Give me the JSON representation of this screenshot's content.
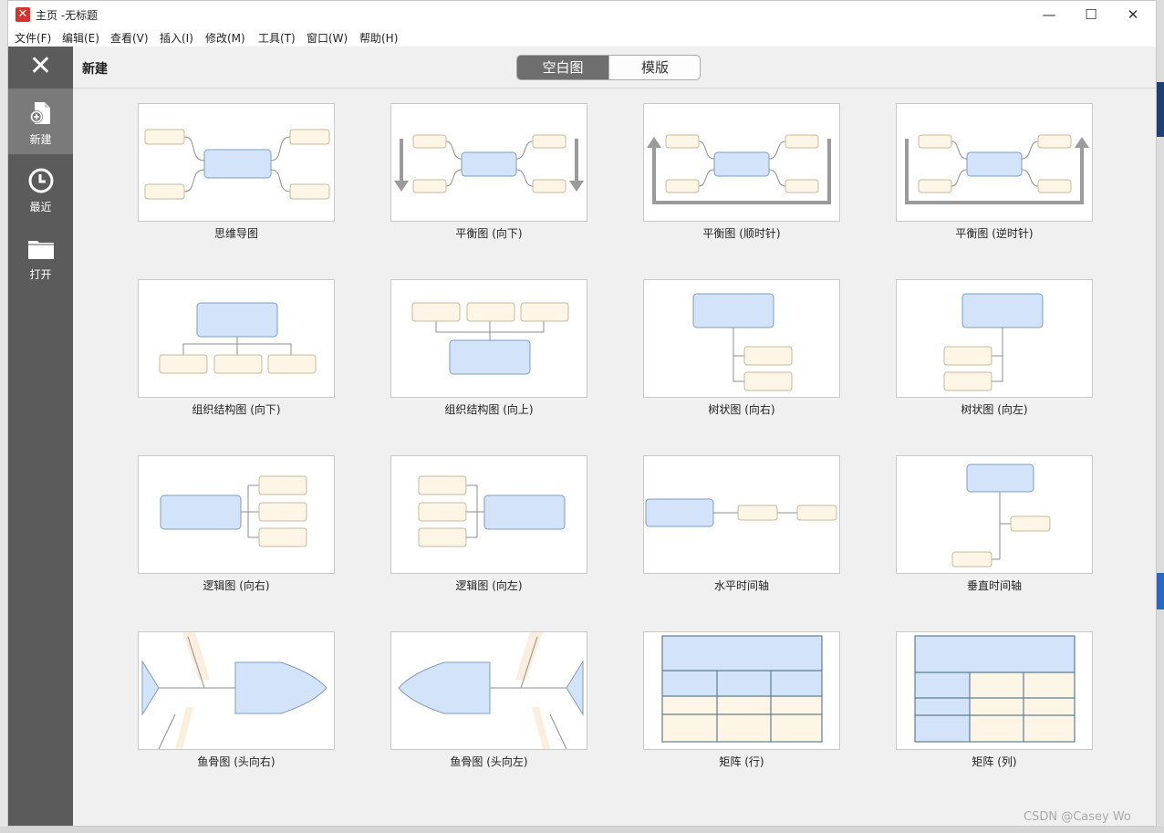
{
  "window": {
    "title": "主页 -无标题",
    "logo_glyph": "✕",
    "controls": {
      "minimize": "—",
      "maximize": "☐",
      "close": "✕"
    }
  },
  "menu": [
    "文件(F)",
    "编辑(E)",
    "查看(V)",
    "插入(I)",
    "修改(M)",
    "工具(T)",
    "窗口(W)",
    "帮助(H)"
  ],
  "sidebar": {
    "close_glyph": "✕",
    "items": [
      {
        "label": "新建",
        "icon": "new-file-icon",
        "active": true
      },
      {
        "label": "最近",
        "icon": "clock-icon",
        "active": false
      },
      {
        "label": "打开",
        "icon": "folder-icon",
        "active": false
      }
    ]
  },
  "header": {
    "title": "新建",
    "tabs": [
      {
        "label": "空白图",
        "active": true
      },
      {
        "label": "模版",
        "active": false
      }
    ]
  },
  "templates": [
    {
      "label": "思维导图",
      "kind": "mindmap"
    },
    {
      "label": "平衡图 (向下)",
      "kind": "balance-down"
    },
    {
      "label": "平衡图 (顺时针)",
      "kind": "balance-cw"
    },
    {
      "label": "平衡图 (逆时针)",
      "kind": "balance-ccw"
    },
    {
      "label": "组织结构图 (向下)",
      "kind": "org-down"
    },
    {
      "label": "组织结构图 (向上)",
      "kind": "org-up"
    },
    {
      "label": "树状图 (向右)",
      "kind": "tree-right"
    },
    {
      "label": "树状图 (向左)",
      "kind": "tree-left"
    },
    {
      "label": "逻辑图 (向右)",
      "kind": "logic-right"
    },
    {
      "label": "逻辑图 (向左)",
      "kind": "logic-left"
    },
    {
      "label": "水平时间轴",
      "kind": "timeline-h"
    },
    {
      "label": "垂直时间轴",
      "kind": "timeline-v"
    },
    {
      "label": "鱼骨图 (头向右)",
      "kind": "fish-right"
    },
    {
      "label": "鱼骨图 (头向左)",
      "kind": "fish-left"
    },
    {
      "label": "矩阵 (行)",
      "kind": "matrix-row"
    },
    {
      "label": "矩阵 (列)",
      "kind": "matrix-col"
    }
  ],
  "colors": {
    "main_topic": "#d2e3fa",
    "sub_topic": "#fdf5e6",
    "line": "#8c8c8c",
    "sidebar": "#5b5b5b"
  },
  "watermark": "CSDN @Casey Wo"
}
